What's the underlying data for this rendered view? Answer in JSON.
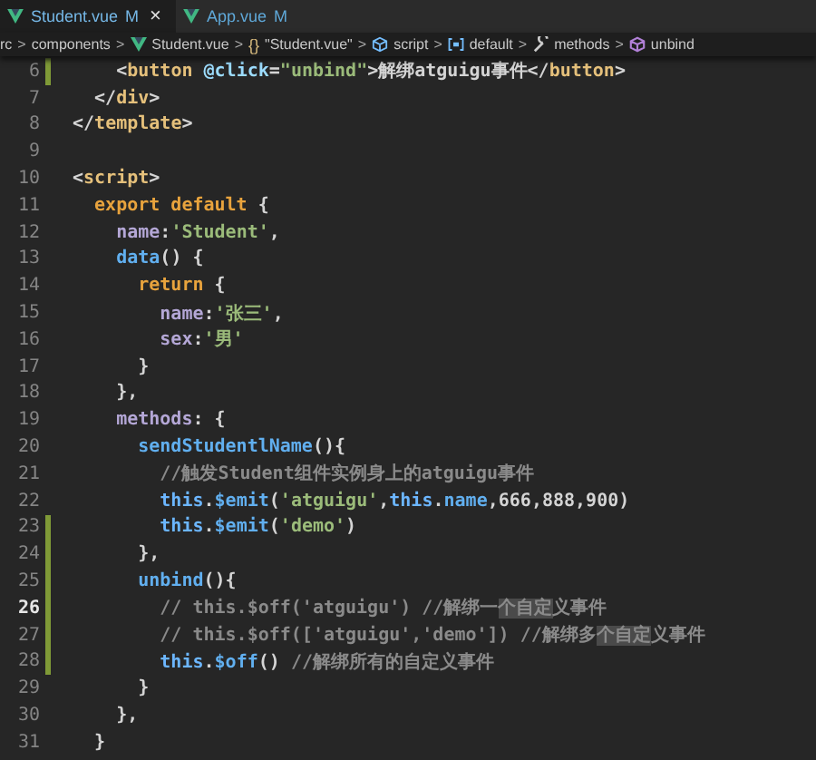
{
  "tabs": [
    {
      "label": "Student.vue",
      "badge": "M",
      "close": "×",
      "selected": true
    },
    {
      "label": "App.vue",
      "badge": "M",
      "selected": false
    }
  ],
  "breadcrumb": [
    {
      "kind": "folder",
      "text": "rc"
    },
    {
      "kind": "folder",
      "text": "components"
    },
    {
      "kind": "file",
      "text": "Student.vue"
    },
    {
      "kind": "module",
      "glyph": "{}",
      "text": "\"Student.vue\""
    },
    {
      "kind": "section",
      "text": "script"
    },
    {
      "kind": "variable",
      "text": "default"
    },
    {
      "kind": "property",
      "text": "methods"
    },
    {
      "kind": "method",
      "text": "unbind"
    }
  ],
  "separator": ">",
  "lines": [
    {
      "n": "6",
      "modified": true,
      "current": false,
      "tokens": [
        {
          "kind": "punct",
          "text": "    <"
        },
        {
          "kind": "tag",
          "text": "button"
        },
        {
          "kind": "attr",
          "text": " @click"
        },
        {
          "kind": "punct",
          "text": "="
        },
        {
          "kind": "str",
          "text": "\"unbind\""
        },
        {
          "kind": "punct",
          "text": ">"
        },
        {
          "kind": "plain",
          "text": "解绑atguigu事件"
        },
        {
          "kind": "punct",
          "text": "</"
        },
        {
          "kind": "tag",
          "text": "button"
        },
        {
          "kind": "punct",
          "text": ">"
        }
      ]
    },
    {
      "n": "7",
      "modified": false,
      "current": false,
      "tokens": [
        {
          "kind": "punct",
          "text": "  </"
        },
        {
          "kind": "tag",
          "text": "div"
        },
        {
          "kind": "punct",
          "text": ">"
        }
      ]
    },
    {
      "n": "8",
      "modified": false,
      "current": false,
      "tokens": [
        {
          "kind": "punct",
          "text": "</"
        },
        {
          "kind": "tag",
          "text": "template"
        },
        {
          "kind": "punct",
          "text": ">"
        }
      ]
    },
    {
      "n": "9",
      "modified": false,
      "current": false
    },
    {
      "n": "10",
      "modified": false,
      "current": false,
      "tokens": [
        {
          "kind": "punct",
          "text": "<"
        },
        {
          "kind": "tag",
          "text": "script"
        },
        {
          "kind": "punct",
          "text": ">"
        }
      ]
    },
    {
      "n": "11",
      "modified": false,
      "current": false,
      "tokens": [
        {
          "kind": "kw",
          "text": "  export default"
        },
        {
          "kind": "punct",
          "text": " {"
        }
      ]
    },
    {
      "n": "12",
      "modified": false,
      "current": false,
      "tokens": [
        {
          "kind": "prop",
          "text": "    name"
        },
        {
          "kind": "punct",
          "text": ":"
        },
        {
          "kind": "str",
          "text": "'Student'"
        },
        {
          "kind": "punct",
          "text": ","
        }
      ]
    },
    {
      "n": "13",
      "modified": false,
      "current": false,
      "tokens": [
        {
          "kind": "fn",
          "text": "    data"
        },
        {
          "kind": "punct",
          "text": "() {"
        }
      ]
    },
    {
      "n": "14",
      "modified": false,
      "current": false,
      "tokens": [
        {
          "kind": "kw",
          "text": "      return"
        },
        {
          "kind": "punct",
          "text": " {"
        }
      ]
    },
    {
      "n": "15",
      "modified": false,
      "current": false,
      "tokens": [
        {
          "kind": "prop",
          "text": "        name"
        },
        {
          "kind": "punct",
          "text": ":"
        },
        {
          "kind": "str",
          "text": "'张三'"
        },
        {
          "kind": "punct",
          "text": ","
        }
      ]
    },
    {
      "n": "16",
      "modified": false,
      "current": false,
      "tokens": [
        {
          "kind": "prop",
          "text": "        sex"
        },
        {
          "kind": "punct",
          "text": ":"
        },
        {
          "kind": "str",
          "text": "'男'"
        }
      ]
    },
    {
      "n": "17",
      "modified": false,
      "current": false,
      "tokens": [
        {
          "kind": "punct",
          "text": "      }"
        }
      ]
    },
    {
      "n": "18",
      "modified": false,
      "current": false,
      "tokens": [
        {
          "kind": "punct",
          "text": "    },"
        }
      ]
    },
    {
      "n": "19",
      "modified": false,
      "current": false,
      "tokens": [
        {
          "kind": "prop",
          "text": "    methods"
        },
        {
          "kind": "punct",
          "text": ": {"
        }
      ]
    },
    {
      "n": "20",
      "modified": false,
      "current": false,
      "tokens": [
        {
          "kind": "fn",
          "text": "      sendStudentlName"
        },
        {
          "kind": "punct",
          "text": "(){"
        }
      ]
    },
    {
      "n": "21",
      "modified": false,
      "current": false,
      "tokens": [
        {
          "kind": "comment",
          "text": "        //触发Student组件实例身上的atguigu事件"
        }
      ]
    },
    {
      "n": "22",
      "modified": false,
      "current": false,
      "tokens": [
        {
          "kind": "this",
          "text": "        this"
        },
        {
          "kind": "punct",
          "text": "."
        },
        {
          "kind": "fn",
          "text": "$emit"
        },
        {
          "kind": "punct",
          "text": "("
        },
        {
          "kind": "str",
          "text": "'atguigu'"
        },
        {
          "kind": "punct",
          "text": ","
        },
        {
          "kind": "this",
          "text": "this"
        },
        {
          "kind": "punct",
          "text": "."
        },
        {
          "kind": "fn",
          "text": "name"
        },
        {
          "kind": "punct",
          "text": ",666,888,900)"
        }
      ]
    },
    {
      "n": "23",
      "modified": true,
      "current": false,
      "tokens": [
        {
          "kind": "this",
          "text": "        this"
        },
        {
          "kind": "punct",
          "text": "."
        },
        {
          "kind": "fn",
          "text": "$emit"
        },
        {
          "kind": "punct",
          "text": "("
        },
        {
          "kind": "str",
          "text": "'demo'"
        },
        {
          "kind": "punct",
          "text": ")"
        }
      ]
    },
    {
      "n": "24",
      "modified": true,
      "current": false,
      "tokens": [
        {
          "kind": "punct",
          "text": "      },"
        }
      ]
    },
    {
      "n": "25",
      "modified": true,
      "current": false,
      "tokens": [
        {
          "kind": "fn",
          "text": "      unbind"
        },
        {
          "kind": "punct",
          "text": "(){"
        }
      ]
    },
    {
      "n": "26",
      "modified": true,
      "current": true,
      "tokens": [
        {
          "kind": "comment",
          "text": "        // this.$off('atguigu') //解绑一"
        },
        {
          "kind": "match",
          "text": "个自定"
        },
        {
          "kind": "comment",
          "text": "义事件"
        }
      ]
    },
    {
      "n": "27",
      "modified": true,
      "current": false,
      "tokens": [
        {
          "kind": "comment",
          "text": "        // this.$off(['atguigu','demo']) //解绑多"
        },
        {
          "kind": "match",
          "text": "个自定"
        },
        {
          "kind": "comment",
          "text": "义事件"
        }
      ]
    },
    {
      "n": "28",
      "modified": true,
      "current": false,
      "tokens": [
        {
          "kind": "this",
          "text": "        this"
        },
        {
          "kind": "punct",
          "text": "."
        },
        {
          "kind": "fn",
          "text": "$off"
        },
        {
          "kind": "punct",
          "text": "() "
        },
        {
          "kind": "comment",
          "text": "//解绑所有的自定义事件"
        }
      ]
    },
    {
      "n": "29",
      "modified": false,
      "current": false,
      "tokens": [
        {
          "kind": "punct",
          "text": "      }"
        }
      ]
    },
    {
      "n": "30",
      "modified": false,
      "current": false,
      "tokens": [
        {
          "kind": "punct",
          "text": "    },"
        }
      ]
    },
    {
      "n": "31",
      "modified": false,
      "current": false,
      "tokens": [
        {
          "kind": "punct",
          "text": "  }"
        }
      ]
    }
  ]
}
